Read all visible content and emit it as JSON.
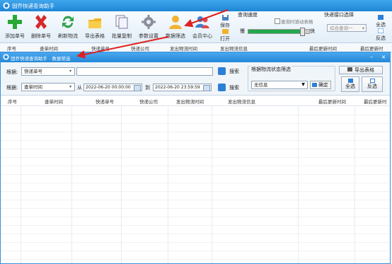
{
  "main_window": {
    "title": "固乔快递查询助手",
    "toolbar": {
      "buttons": [
        {
          "label": "添加单号",
          "icon": "add-icon"
        },
        {
          "label": "删除单号",
          "icon": "delete-icon"
        },
        {
          "label": "刷新物流",
          "icon": "refresh-icon"
        },
        {
          "label": "导出表格",
          "icon": "export-icon"
        },
        {
          "label": "批量复制",
          "icon": "copy-icon"
        },
        {
          "label": "参数设置",
          "icon": "settings-icon"
        },
        {
          "label": "数据筛选",
          "icon": "user-filter-icon"
        },
        {
          "label": "会员中心",
          "icon": "member-icon"
        }
      ],
      "save_label": "保存",
      "open_label": "打开",
      "speed_group": {
        "title": "查询速度",
        "realtime_label": "查询时滚动表格",
        "slow_label": "慢",
        "fast_label": "快",
        "level": 0.88
      },
      "interface_group": {
        "title": "快递接口选择",
        "selected": "综合查询一"
      },
      "select_all_label": "全选",
      "invert_label": "反选"
    },
    "columns": [
      "序号",
      "查单时间",
      "快递单号",
      "快递公司",
      "发出物流时间",
      "发出物流信息",
      "最后更新时间",
      "最后更新时"
    ]
  },
  "dialog": {
    "title": "固乔快递查询助手 - 数据筛选",
    "filter": {
      "row1_label": "根据:",
      "row1_field": "快递单号",
      "row2_label": "根据:",
      "row2_field": "查单时间",
      "from_label": "从",
      "to_label": "到",
      "date_from": "2022-06-20 00:00:00",
      "date_to": "2022-06-20 23:59:59",
      "search_label": "搜索",
      "status_group_title": "根据物流状态筛选",
      "status_selected": "无信息",
      "ok_label": "确定",
      "export_label": "导出表格",
      "select_all_label": "全选",
      "invert_label": "反选"
    },
    "columns": [
      "序号",
      "查单时间",
      "快递单号",
      "快递公司",
      "发出物流时间",
      "发出物流信息",
      "最后更新时间",
      "最后更新时"
    ]
  }
}
